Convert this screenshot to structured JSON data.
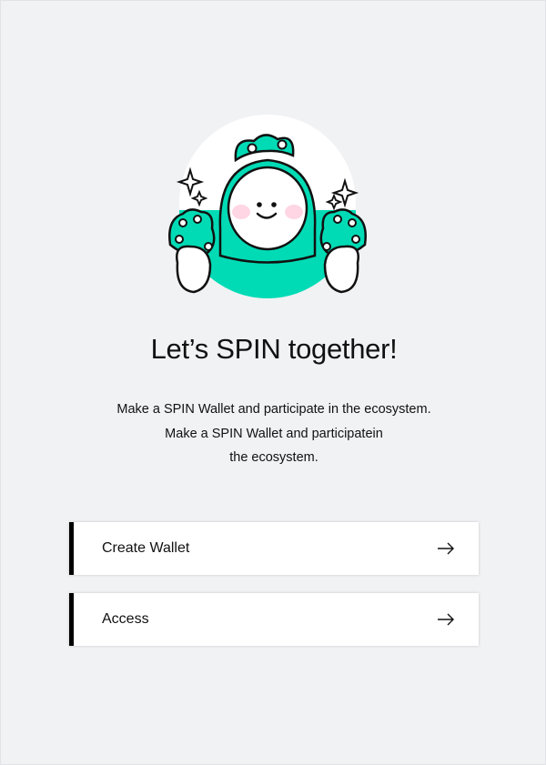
{
  "headline": "Let’s SPIN together!",
  "description": {
    "line1": "Make a SPIN Wallet and participate in the ecosystem.",
    "line2": "Make a SPIN Wallet and participatein",
    "line3": "the ecosystem."
  },
  "actions": {
    "create_label": "Create Wallet",
    "access_label": "Access"
  },
  "colors": {
    "accent": "#00dbb5",
    "background": "#f1f2f4",
    "button_bar": "#000000"
  },
  "icons": {
    "mascot": "frog-mascot-illustration",
    "arrow": "arrow-right-icon"
  }
}
